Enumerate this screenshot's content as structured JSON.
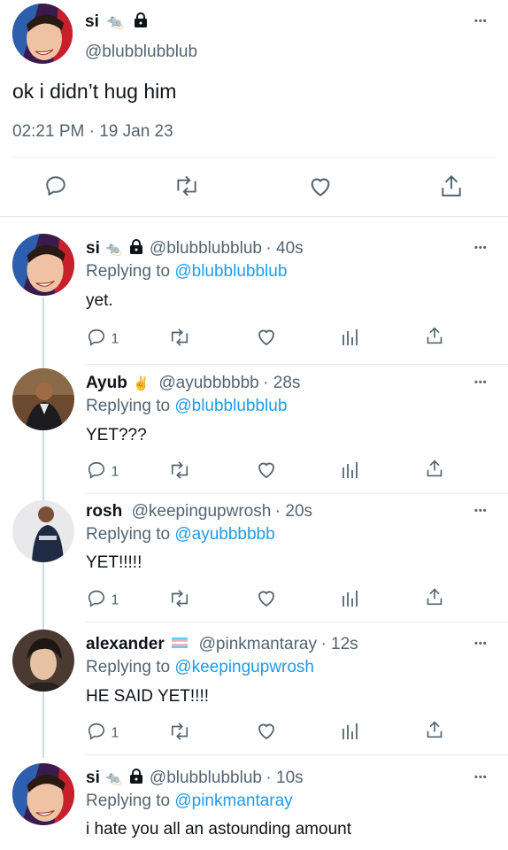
{
  "main_tweet": {
    "name": "si",
    "emoji": "🐀",
    "handle": "@blubblubblub",
    "text": "ok i didn’t hug him",
    "time": "02:21 PM · 19 Jan 23",
    "more": "•••"
  },
  "replies": [
    {
      "name": "si",
      "handle": "@blubblubblub",
      "time": "· 40s",
      "replying_prefix": "Replying to ",
      "replying_to": "@blubblubblub",
      "text": "yet.",
      "reply_count": "1",
      "more": "•••",
      "emoji": "🐀"
    },
    {
      "name": "Ayub",
      "handle": "@ayubbbbbb",
      "time": "· 28s",
      "replying_prefix": "Replying to ",
      "replying_to": "@blubblubblub",
      "text": "YET???",
      "reply_count": "1",
      "more": "•••",
      "emoji": "✌️"
    },
    {
      "name": "rosh",
      "handle": "@keepingupwrosh",
      "time": "· 20s",
      "replying_prefix": "Replying to ",
      "replying_to": "@ayubbbbbb",
      "text": "YET!!!!!",
      "reply_count": "1",
      "more": "•••"
    },
    {
      "name": "alexander",
      "handle": "@pinkmantaray",
      "time": "· 12s",
      "replying_prefix": "Replying to ",
      "replying_to": "@keepingupwrosh",
      "text": "HE SAID YET!!!!",
      "reply_count": "1",
      "more": "•••"
    },
    {
      "name": "si",
      "handle": "@blubblubblub",
      "time": "· 10s",
      "replying_prefix": "Replying to ",
      "replying_to": "@pinkmantaray",
      "text": "i hate you all an astounding amount",
      "more": "•••",
      "emoji": "🐀"
    }
  ],
  "colors": {
    "link": "#1d9bf0",
    "secondary": "#536471",
    "text": "#0f1419",
    "divider": "#e6ecf0"
  }
}
